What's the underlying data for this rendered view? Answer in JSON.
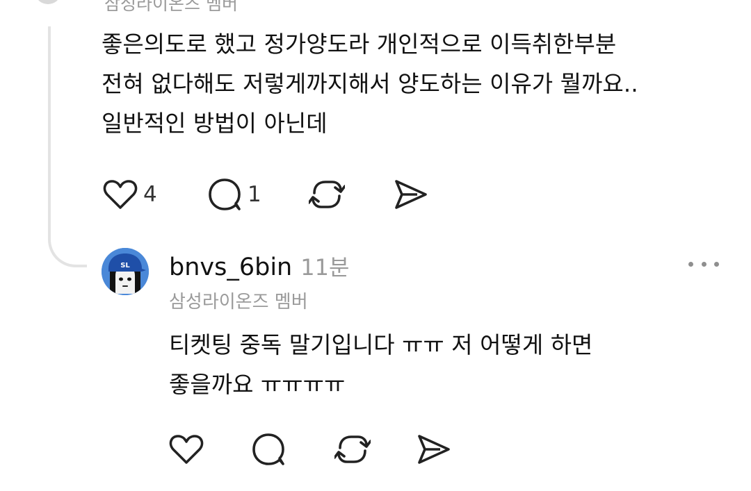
{
  "parent_comment": {
    "subtitle_cut": "삼성라이온즈 멤버",
    "text_lines": [
      "좋은의도로 했고 정가양도라 개인적으로 이득취한부분",
      "전혀 없다해도 저렇게까지해서 양도하는 이유가 뭘까요..",
      "일반적인 방법이 아닌데"
    ],
    "likes": "4",
    "replies": "1"
  },
  "reply_comment": {
    "username": "bnvs_6bin",
    "timestamp": "11분",
    "subtitle": "삼성라이온즈 멤버",
    "avatar_cap_text": "SL",
    "text_lines": [
      "티켓팅 중독 말기입니다 ㅠㅠ 저 어떻게 하면",
      "좋을까요 ㅠㅠㅠㅠ"
    ]
  },
  "icons": {
    "like": "heart-icon",
    "reply": "comment-bubble-icon",
    "repost": "repost-arrows-icon",
    "share": "send-arrow-icon",
    "more": "more-dots-icon"
  },
  "colors": {
    "avatar_bg": "#4a88d8",
    "cap": "#1f4fa8",
    "muted_text": "#9a9a9a",
    "thread_line": "#e3e3e3"
  }
}
